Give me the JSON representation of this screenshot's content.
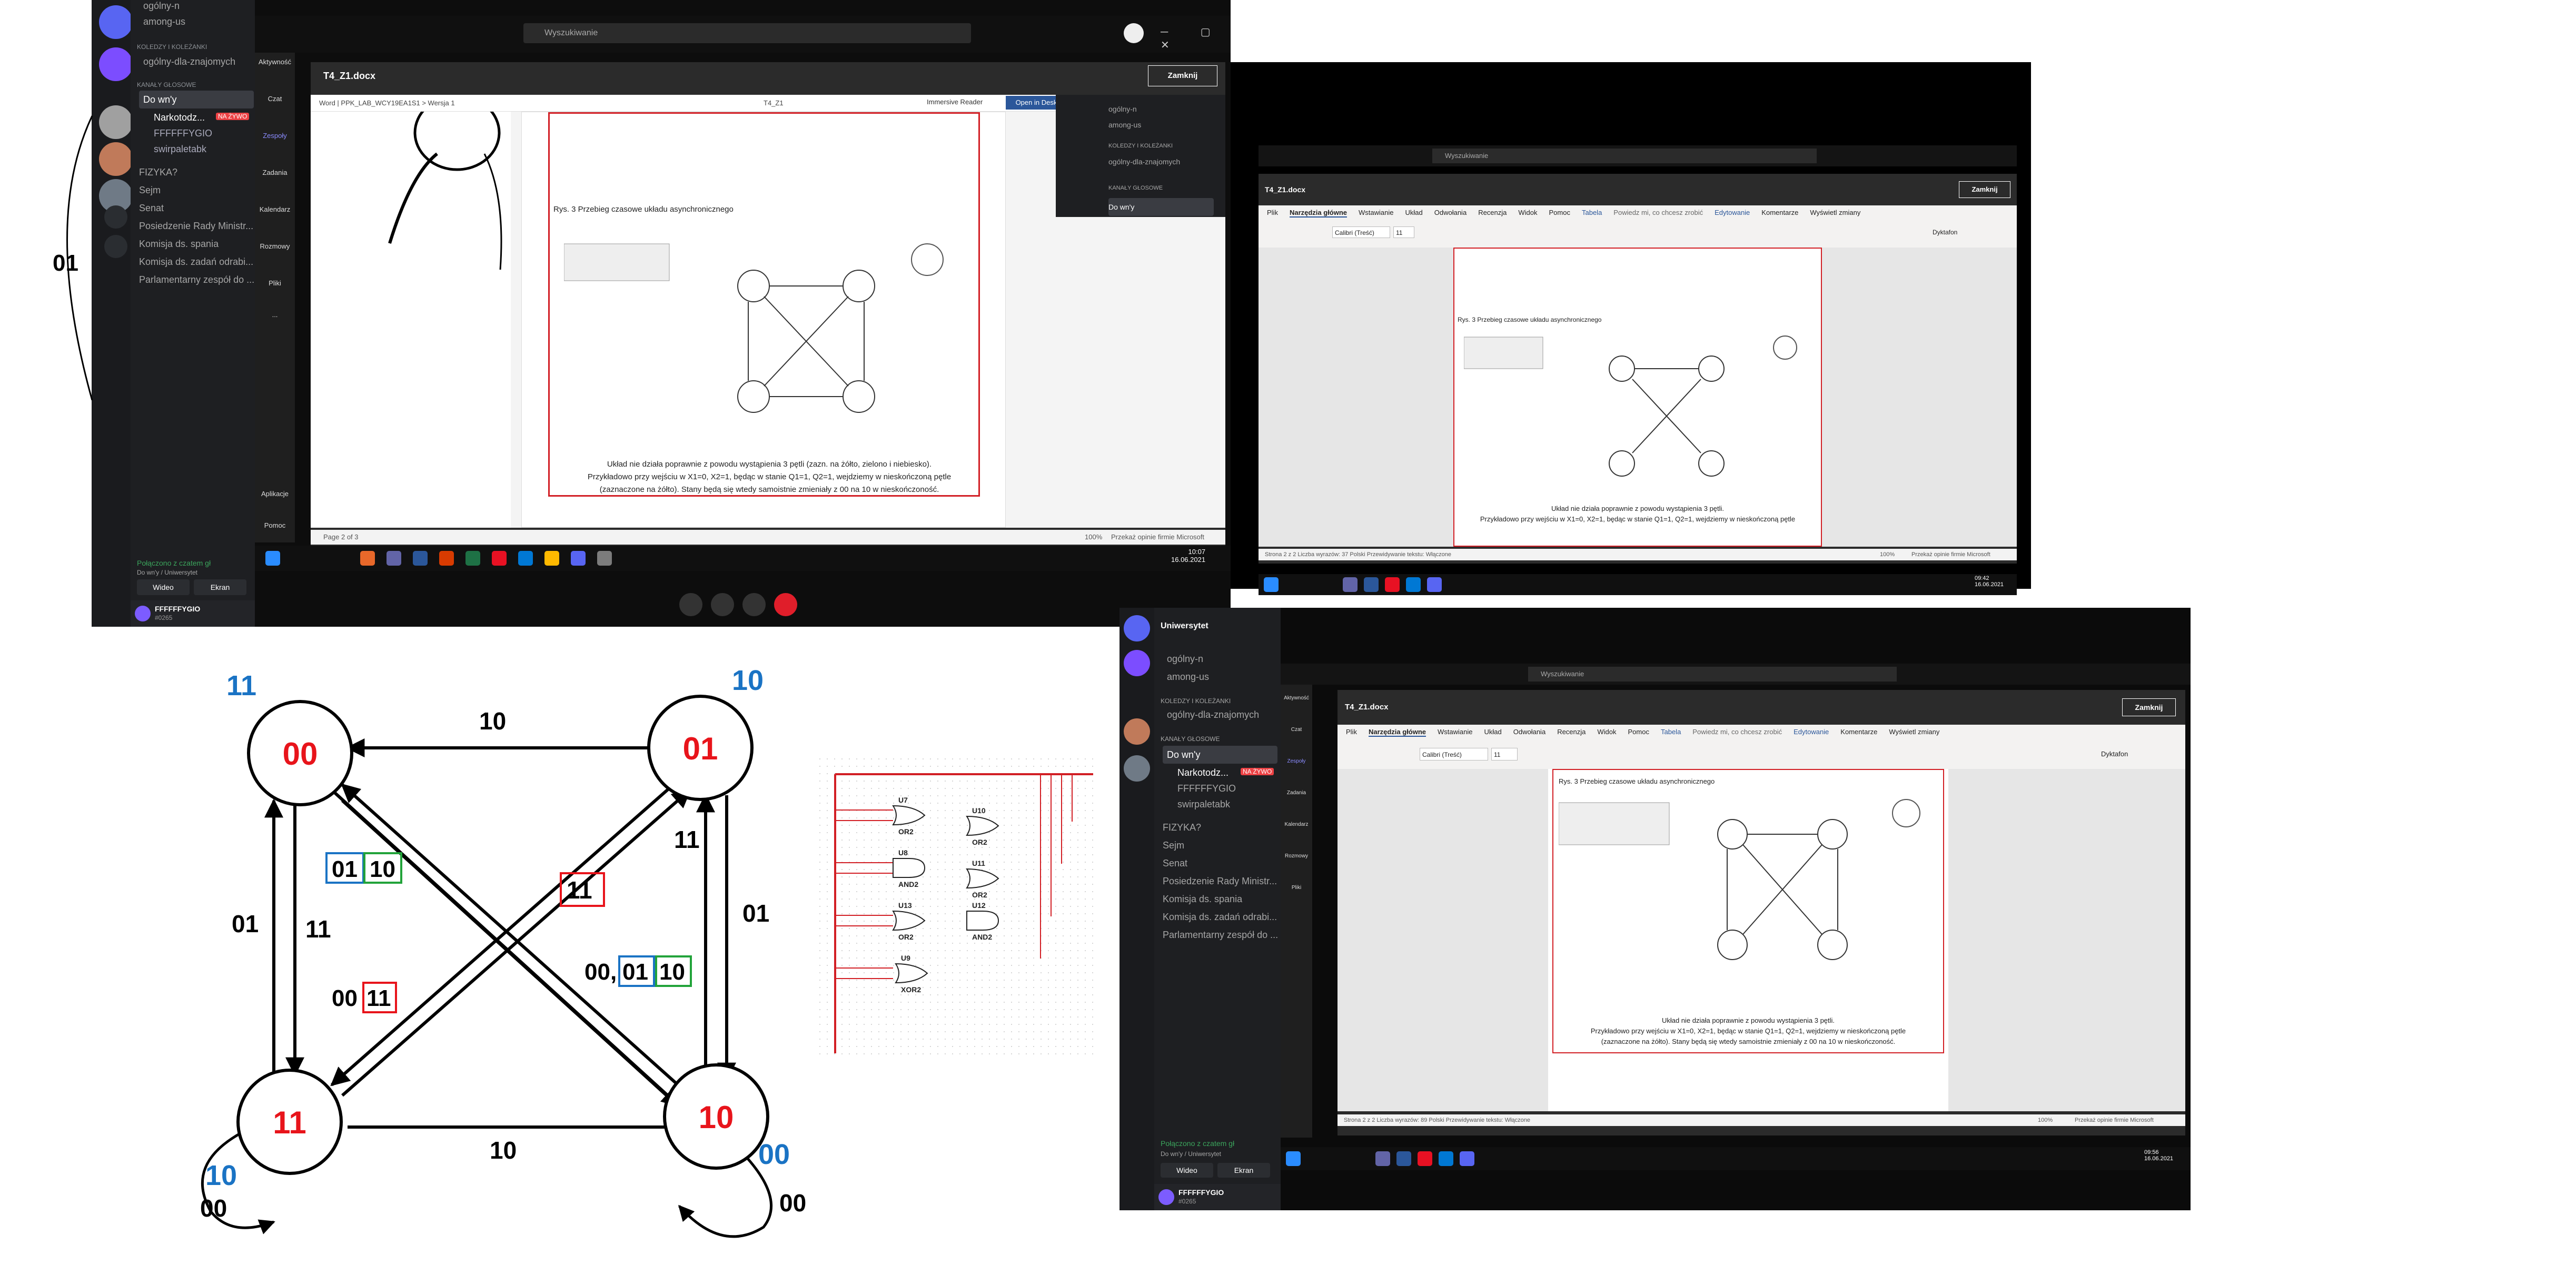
{
  "top_window": {
    "search_placeholder": "Wyszukiwanie",
    "doc_title": "T4_Z1.docx",
    "close_button": "Zamknij",
    "doc_bar_left": "Word | PPK_LAB_WCY19EA1S1 > Wersja 1",
    "doc_bar_center": "T4_Z1",
    "immersive_reader": "Immersive Reader",
    "open_desktop": "Open in Desktop App",
    "figure_caption": "Rys. 3 Przebieg czasowe układu asynchronicznego",
    "body_text_1": "Układ nie działa poprawnie z powodu wystąpienia 3 pętli (zazn. na żółto, zielono i niebiesko).",
    "body_text_2": "Przykładowo przy wejściu w X1=0, X2=1, będąc w stanie Q1=1, Q2=1, wejdziemy w nieskończoną pętle",
    "body_text_3": "(zaznaczone na żółto). Stany będą się wtedy samoistnie zmieniały z 00 na 10 w nieskończoność.",
    "page_info": "Page 2 of 3",
    "zoom": "100%",
    "footer_right": "Przekaż opinie firmie Microsoft",
    "clock_time": "10:07",
    "clock_date": "16.06.2021"
  },
  "discord_top": {
    "channels_top": [
      "ogólny-n",
      "among-us"
    ],
    "group_colleagues": "KOLEDZY I KOLEŻANKI",
    "channel_colleagues": "ogólny-dla-znajomych",
    "group_voice": "KANAŁY GŁOSOWE",
    "voice_channels": [
      "Do wn'y",
      "FIZYKA?",
      "Sejm",
      "Senat",
      "Posiedzenie Rady Ministr...",
      "Komisja ds. spania",
      "Komisja ds. zadań odrabi...",
      "Parlamentarny zespół do ..."
    ],
    "users": [
      "Narkotodz...",
      "FFFFFFYGIO",
      "swirpaletabk"
    ],
    "live_badge": "NA ŻYWO",
    "connected": "Połączono z czatem gł",
    "connected_sub": "Do wn'y / Uniwersytet",
    "video_btn": "Wideo",
    "screen_btn": "Ekran",
    "username": "FFFFFFYGIO",
    "user_tag": "#0265"
  },
  "teams_rail": [
    "Aktywność",
    "Czat",
    "Zespoły",
    "Zadania",
    "Kalendarz",
    "Rozmowy",
    "Pliki",
    "...",
    "Aplikacje",
    "Pomoc"
  ],
  "right_top_window": {
    "search_placeholder": "Wyszukiwanie",
    "doc_title": "T4_Z1.docx",
    "close_button": "Zamknij",
    "tabs": [
      "Plik",
      "Narzędzia główne",
      "Wstawianie",
      "Układ",
      "Odwołania",
      "Recenzja",
      "Widok",
      "Pomoc",
      "Tabela"
    ],
    "tell_me": "Powiedz mi, co chcesz zrobić",
    "editing": "Edytowanie",
    "comments": "Komentarze",
    "changes": "Wyświetl zmiany",
    "font": "Calibri (Treść)",
    "font_size": "11",
    "dictate": "Dyktafon",
    "figure_caption": "Rys. 3 Przebieg czasowe układu asynchronicznego",
    "body_text_1": "Układ nie działa poprawnie z powodu wystąpienia 3 pętli.",
    "body_text_2": "Przykładowo przy wejściu w X1=0, X2=1, będąc w stanie Q1=1, Q2=1, wejdziemy w nieskończoną pętle",
    "status_left": "Strona 2 z 2   Liczba wyrazów: 37   Polski   Przewidywanie tekstu: Włączone",
    "zoom": "100%",
    "feedback": "Przekaż opinie firmie Microsoft",
    "clock_time": "09:42",
    "clock_date": "16.06.2021"
  },
  "right_bottom_window": {
    "search_placeholder": "Wyszukiwanie",
    "doc_title": "T4_Z1.docx",
    "close_button": "Zamknij",
    "tabs": [
      "Plik",
      "Narzędzia główne",
      "Wstawianie",
      "Układ",
      "Odwołania",
      "Recenzja",
      "Widok",
      "Pomoc",
      "Tabela"
    ],
    "tell_me": "Powiedz mi, co chcesz zrobić",
    "editing": "Edytowanie",
    "comments": "Komentarze",
    "changes": "Wyświetl zmiany",
    "font": "Calibri (Treść)",
    "font_size": "11",
    "dictate": "Dyktafon",
    "figure_caption": "Rys. 3 Przebieg czasowe układu asynchronicznego",
    "body_text_1": "Układ nie działa poprawnie z powodu wystąpienia 3 pętli.",
    "body_text_2": "Przykładowo przy wejściu w X1=0, X2=1, będąc w stanie Q1=1, Q2=1, wejdziemy w nieskończoną pętle",
    "body_text_3": "(zaznaczone na żółto). Stany będą się wtedy samoistnie zmieniały z 00 na 10 w nieskończoność.",
    "status_left": "Strona 2 z 2   Liczba wyrazów: 89   Polski   Przewidywanie tekstu: Włączone",
    "zoom": "100%",
    "feedback": "Przekaż opinie firmie Microsoft",
    "clock_time": "09:56",
    "clock_date": "16.06.2021"
  },
  "discord_bottom": {
    "server_header": "Uniwersytet",
    "channels_top": [
      "ogólny-n",
      "among-us"
    ],
    "group_colleagues": "KOLEDZY I KOLEŻANKI",
    "channel_colleagues": "ogólny-dla-znajomych",
    "group_voice": "KANAŁY GŁOSOWE",
    "voice_channels": [
      "Do wn'y",
      "FIZYKA?",
      "Sejm",
      "Senat",
      "Posiedzenie Rady Ministr...",
      "Komisja ds. spania",
      "Komisja ds. zadań odrabi...",
      "Parlamentarny zespół do ..."
    ],
    "users": [
      "Narkotodz...",
      "FFFFFFYGIO",
      "swirpaletabk"
    ],
    "live_badge": "NA ŻYWO",
    "connected": "Połączono z czatem gł",
    "connected_sub": "Do wn'y / Uniwersytet",
    "video_btn": "Wideo",
    "screen_btn": "Ekran",
    "username": "FFFFFFYGIO",
    "user_tag": "#0265"
  },
  "state_diagram": {
    "states": [
      {
        "code": "00",
        "input_label": "11"
      },
      {
        "code": "01",
        "input_label": "10"
      },
      {
        "code": "11",
        "input_label": "10"
      },
      {
        "code": "10",
        "input_label": "00"
      }
    ],
    "self_loop_labels": [
      "00",
      "00"
    ],
    "edge_labels": {
      "top": "10",
      "bottom": "10",
      "left_outer": "01",
      "left_inner": "11",
      "right_outer": "01",
      "right_inner": "11",
      "diag_blue": "01",
      "diag_green": "10",
      "diag_red_small": "11",
      "diag_red_prefix": "00",
      "diag_right_prefix": "00,",
      "diag_right_blue": "01",
      "diag_right_green": "10",
      "box_red_center": "11"
    },
    "edge_left_fragment": "01"
  },
  "circuit": {
    "gates": [
      {
        "id": "U7",
        "type": "OR2"
      },
      {
        "id": "U10",
        "type": "OR2"
      },
      {
        "id": "U8",
        "type": "AND2"
      },
      {
        "id": "U11",
        "type": "OR2"
      },
      {
        "id": "U13",
        "type": "OR2"
      },
      {
        "id": "U12",
        "type": "AND2"
      },
      {
        "id": "U9",
        "type": "XOR2"
      }
    ]
  },
  "colors": {
    "red": "#e8141b",
    "blue": "#1a73c4",
    "green": "#22a33a"
  }
}
